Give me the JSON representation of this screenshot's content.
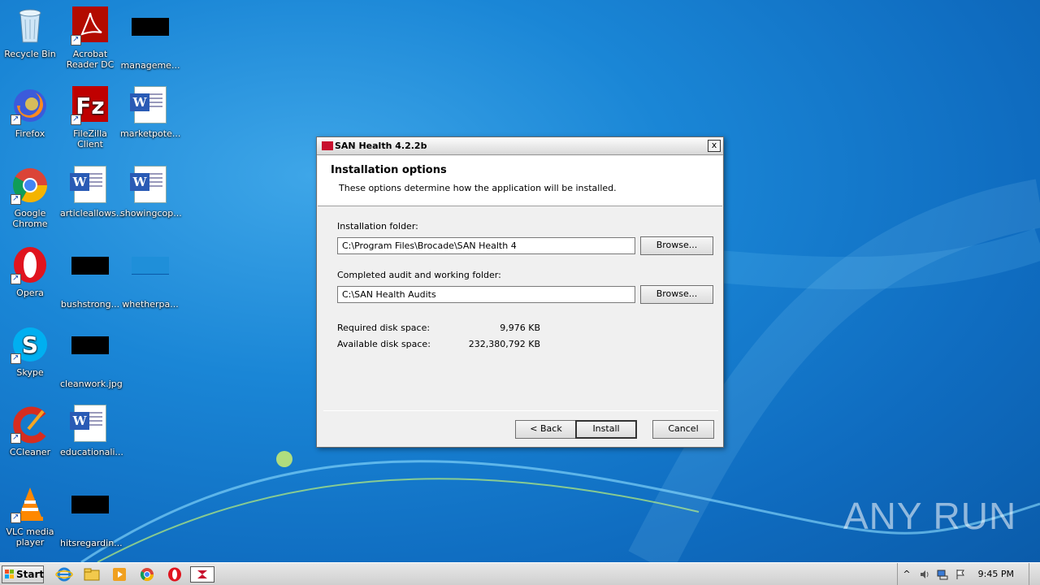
{
  "desktop": {
    "icons": [
      {
        "label": "Recycle Bin",
        "label2": ""
      },
      {
        "label": "Acrobat",
        "label2": "Reader DC"
      },
      {
        "label": "manageme...",
        "label2": ""
      },
      {
        "label": "Firefox",
        "label2": ""
      },
      {
        "label": "FileZilla Client",
        "label2": ""
      },
      {
        "label": "marketpote...",
        "label2": ""
      },
      {
        "label": "Google",
        "label2": "Chrome"
      },
      {
        "label": "articleallows...",
        "label2": ""
      },
      {
        "label": "showingcop...",
        "label2": ""
      },
      {
        "label": "Opera",
        "label2": ""
      },
      {
        "label": "bushstrong...",
        "label2": ""
      },
      {
        "label": "whetherpa...",
        "label2": ""
      },
      {
        "label": "Skype",
        "label2": ""
      },
      {
        "label": "cleanwork.jpg",
        "label2": ""
      },
      {
        "label": "CCleaner",
        "label2": ""
      },
      {
        "label": "educationali...",
        "label2": ""
      },
      {
        "label": "VLC media",
        "label2": "player"
      },
      {
        "label": "hitsregardin...",
        "label2": ""
      }
    ]
  },
  "dialog": {
    "title": "SAN Health 4.2.2b",
    "close_label": "x",
    "header_title": "Installation options",
    "header_subtitle": "These options determine how the application will be installed.",
    "install_folder_label": "Installation folder:",
    "install_folder_value": "C:\\Program Files\\Brocade\\SAN Health 4",
    "audit_folder_label": "Completed audit and working folder:",
    "audit_folder_value": "C:\\SAN Health Audits",
    "browse_label": "Browse...",
    "required_label": "Required disk space:",
    "required_value": "9,976 KB",
    "available_label": "Available disk space:",
    "available_value": "232,380,792 KB",
    "back_label": "< Back",
    "install_label": "Install",
    "cancel_label": "Cancel"
  },
  "taskbar": {
    "start_label": "Start",
    "clock": "9:45 PM",
    "pinned": [
      "internet-explorer-icon",
      "file-explorer-icon",
      "media-player-icon",
      "chrome-icon",
      "opera-icon",
      "san-health-icon"
    ]
  },
  "watermark": "ANY RUN",
  "colors": {
    "brand_red": "#c8102e",
    "desktop_blue": "#1a86d6"
  }
}
